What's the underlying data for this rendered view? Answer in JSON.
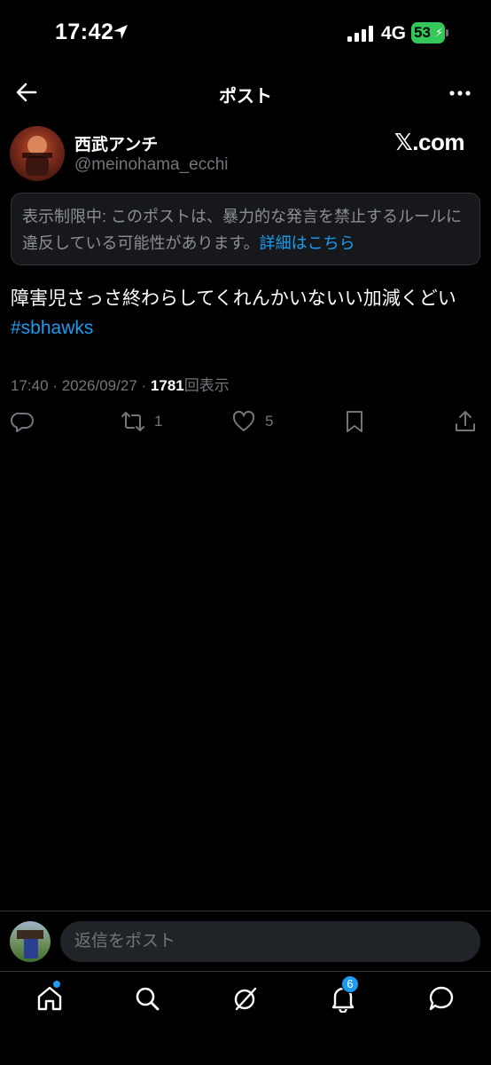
{
  "status_bar": {
    "time": "17:42",
    "network": "4G",
    "battery": "53",
    "icons": [
      "location-arrow-icon",
      "signal-icon",
      "battery-icon"
    ]
  },
  "header": {
    "title": "ポスト",
    "back_icon": "back-arrow-icon",
    "more_icon": "more-icon"
  },
  "post": {
    "author": {
      "display_name": "西武アンチ",
      "username": "@meinohama_ecchi"
    },
    "brand": "𝕏.com",
    "notice": {
      "text": "表示制限中: このポストは、暴力的な発言を禁止するルールに違反している可能性があります。",
      "link": "詳細はこちら"
    },
    "text": "障害児さっさ終わらしてくれんかいないい加減くどい",
    "hashtag": "#sbhawks",
    "meta": {
      "time": "17:40",
      "separator": "·",
      "date": "2026/09/27",
      "views_count": "1781",
      "views_label": "回表示"
    },
    "actions": {
      "reply_icon": "reply-icon",
      "repost_icon": "repost-icon",
      "repost_count": "1",
      "like_icon": "heart-icon",
      "like_count": "5",
      "bookmark_icon": "bookmark-icon",
      "share_icon": "share-icon"
    }
  },
  "reply_bar": {
    "placeholder": "返信をポスト"
  },
  "bottom_nav": {
    "items": [
      "home-icon",
      "search-icon",
      "grok-icon",
      "notifications-icon",
      "messages-icon"
    ],
    "notification_count": "6"
  },
  "colors": {
    "accent": "#1d9bf0",
    "background": "#000000",
    "muted_text": "#71767b",
    "battery_green": "#34c759"
  }
}
